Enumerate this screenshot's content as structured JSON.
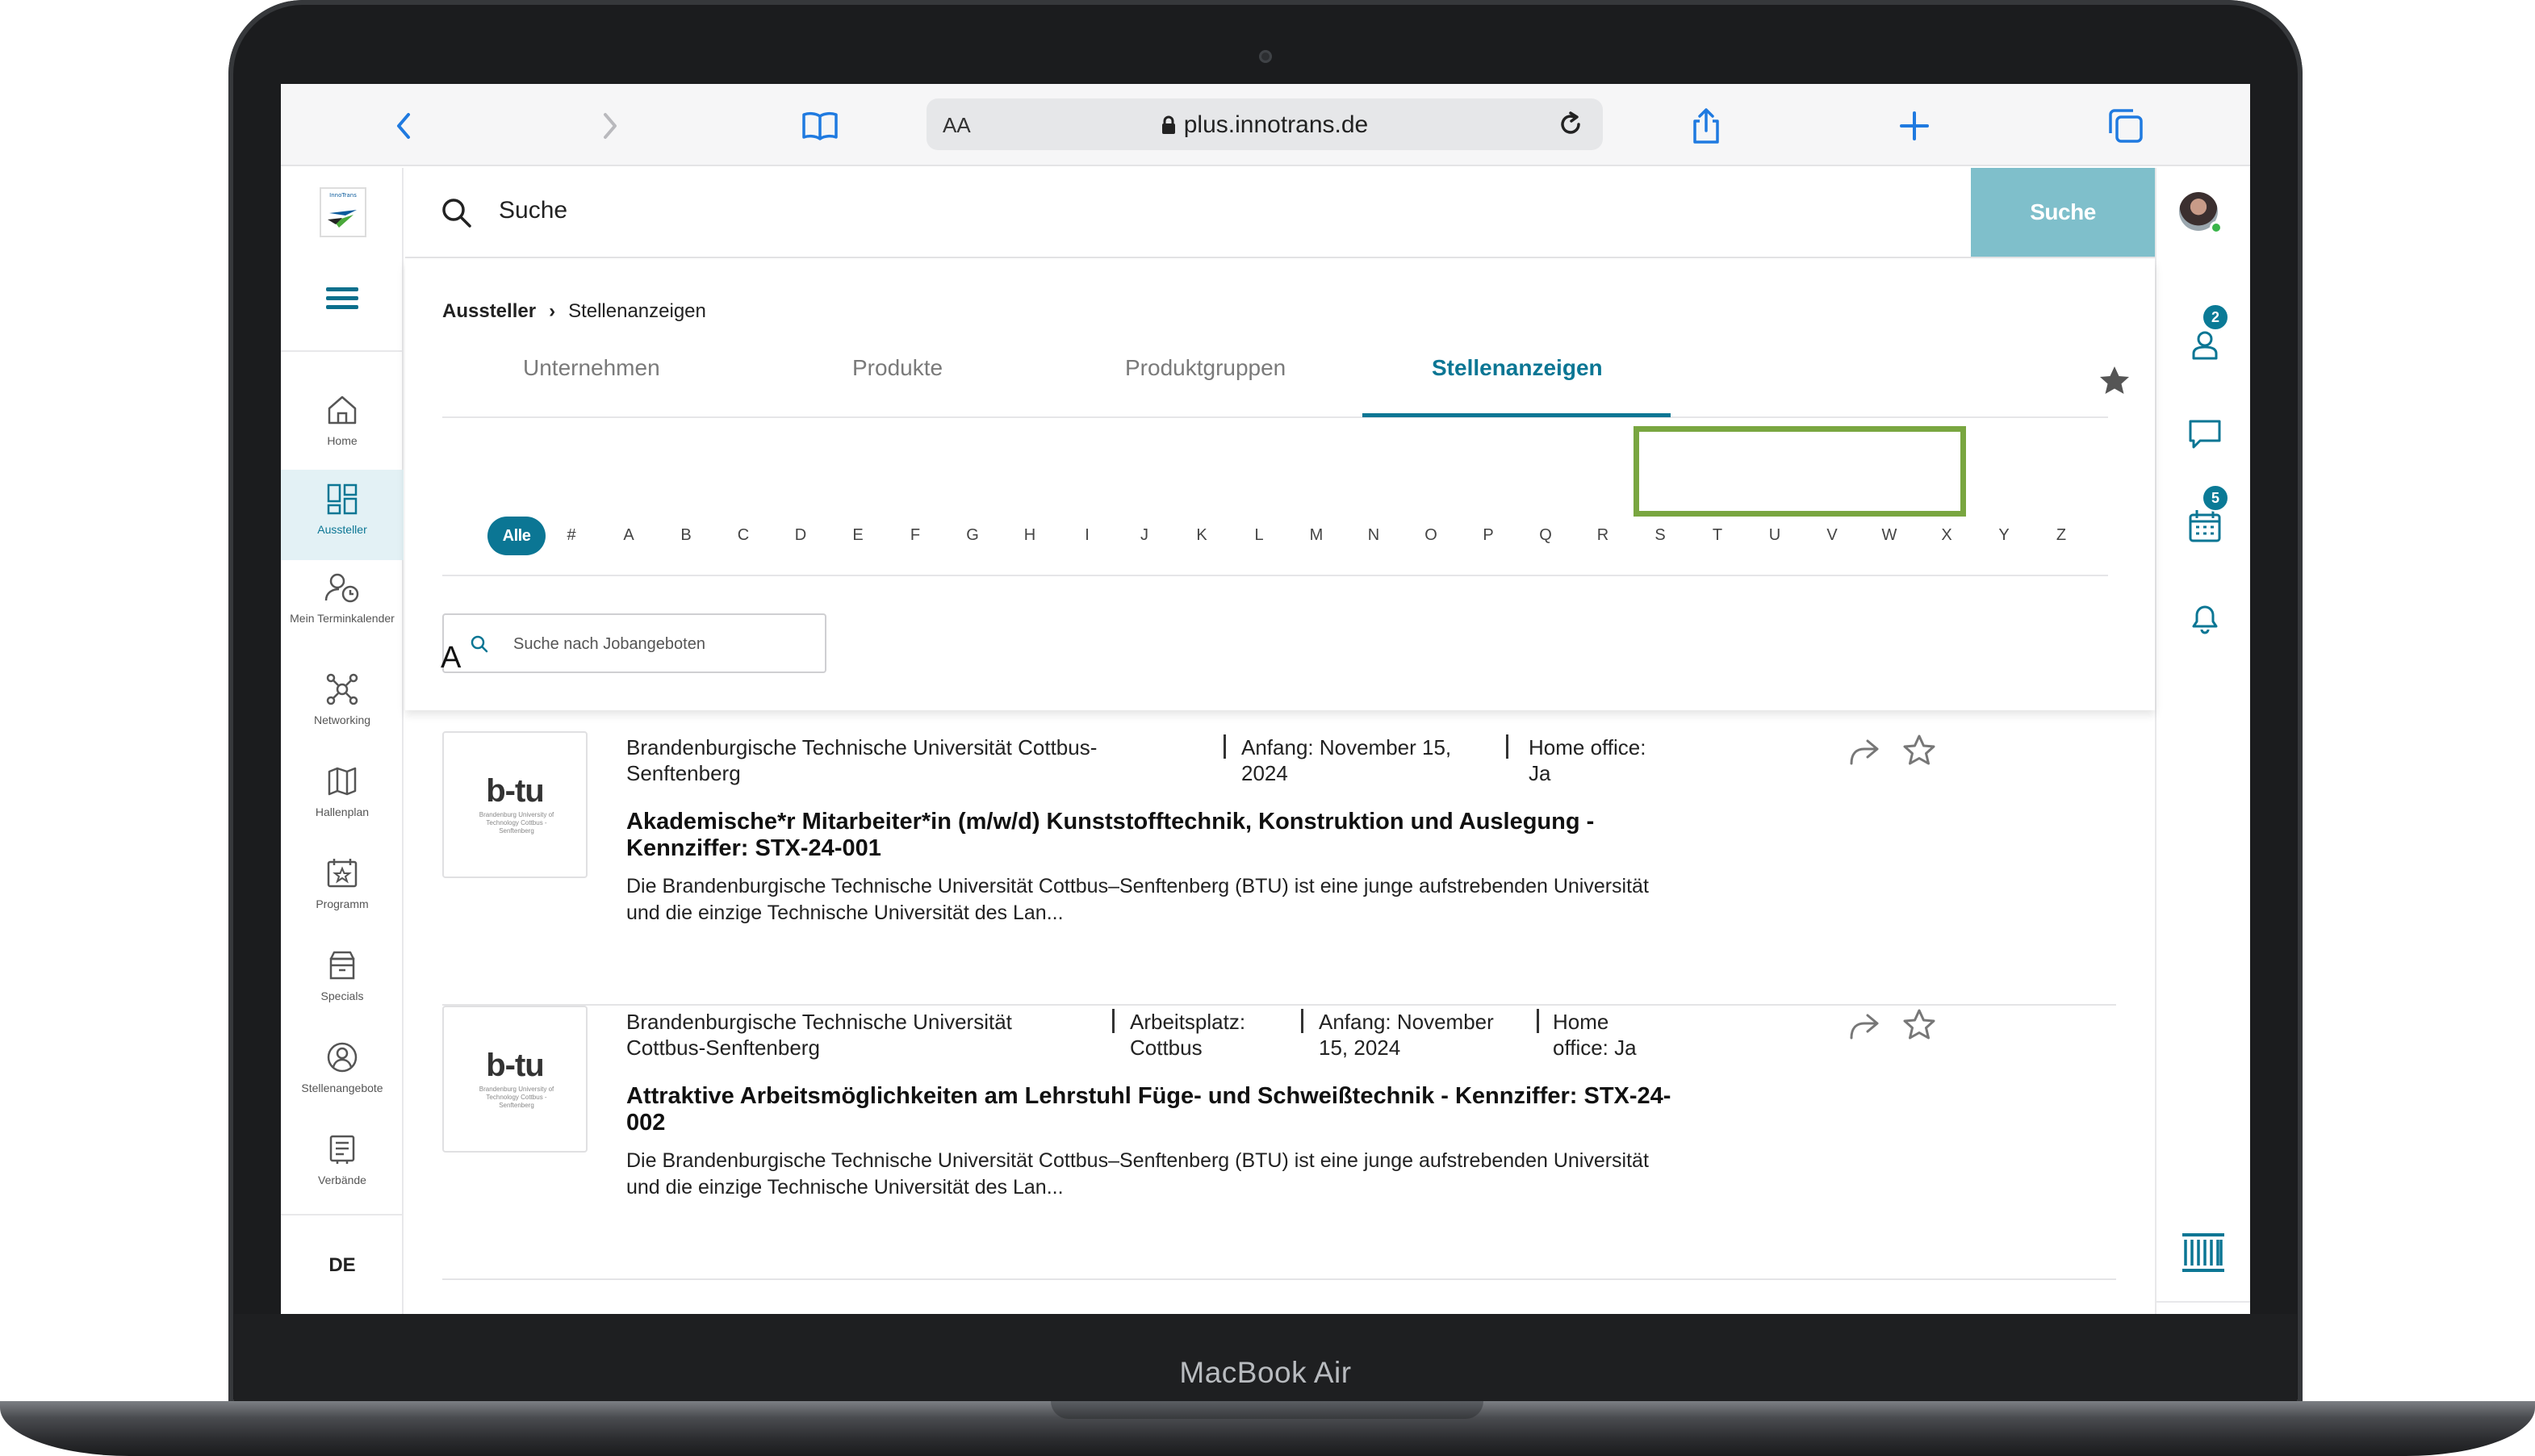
{
  "device": {
    "label": "MacBook Air"
  },
  "browser": {
    "text_size_label": "AA",
    "url": "plus.innotrans.de"
  },
  "sidebar": {
    "items": [
      {
        "label": "Home",
        "icon": "home-icon"
      },
      {
        "label": "Aussteller",
        "icon": "exhibitors-icon",
        "active": true
      },
      {
        "label": "Mein Terminkalender",
        "icon": "calendar-clock-icon"
      },
      {
        "label": "Networking",
        "icon": "networking-icon"
      },
      {
        "label": "Hallenplan",
        "icon": "map-icon"
      },
      {
        "label": "Programm",
        "icon": "program-icon"
      },
      {
        "label": "Specials",
        "icon": "specials-icon"
      },
      {
        "label": "Stellenangebote",
        "icon": "jobs-icon"
      },
      {
        "label": "Verbände",
        "icon": "associations-icon"
      }
    ],
    "language": "DE"
  },
  "top_search": {
    "placeholder": "Suche",
    "button_label": "Suche"
  },
  "rightbar": {
    "contacts_badge": "2",
    "calendar_badge": "5"
  },
  "breadcrumb": {
    "parent": "Aussteller",
    "current": "Stellenanzeigen"
  },
  "tabs": [
    {
      "label": "Unternehmen",
      "active": false
    },
    {
      "label": "Produkte",
      "active": false
    },
    {
      "label": "Produktgruppen",
      "active": false
    },
    {
      "label": "Stellenanzeigen",
      "active": true
    }
  ],
  "alphabet": {
    "all_label": "Alle",
    "letters": [
      "#",
      "A",
      "B",
      "C",
      "D",
      "E",
      "F",
      "G",
      "H",
      "I",
      "J",
      "K",
      "L",
      "M",
      "N",
      "O",
      "P",
      "Q",
      "R",
      "S",
      "T",
      "U",
      "V",
      "W",
      "X",
      "Y",
      "Z"
    ]
  },
  "job_search": {
    "placeholder": "Suche nach Jobangeboten"
  },
  "section_letter": "A",
  "jobs": [
    {
      "logo": "b-tu",
      "logo_sub": "Brandenburg University of Technology Cottbus - Senftenberg",
      "company": "Brandenburgische Technische Universität Cottbus-Senftenberg",
      "start": "Anfang: November 15, 2024",
      "home_office": "Home office: Ja",
      "title": "Akademische*r Mitarbeiter*in (m/w/d) Kunststofftechnik, Konstruktion und Auslegung - Kennziffer: STX-24-001",
      "description": "Die Brandenburgische Technische Universität Cottbus–Senftenberg (BTU) ist eine junge aufstrebenden Universität und die einzige Technische Universität des Lan..."
    },
    {
      "logo": "b-tu",
      "logo_sub": "Brandenburg University of Technology Cottbus - Senftenberg",
      "company": "Brandenburgische Technische Universität Cottbus-Senftenberg",
      "workplace": "Arbeitsplatz: Cottbus",
      "start": "Anfang: November 15, 2024",
      "home_office": "Home office: Ja",
      "title": "Attraktive Arbeitsmöglichkeiten am Lehrstuhl Füge- und Schweißtechnik - Kennziffer: STX-24-002",
      "description": "Die Brandenburgische Technische Universität Cottbus–Senftenberg (BTU) ist eine junge aufstrebenden Universität und die einzige Technische Universität des Lan..."
    }
  ],
  "colors": {
    "accent": "#0b7694",
    "search_button": "#7fbfcb",
    "highlight": "#79a640"
  }
}
